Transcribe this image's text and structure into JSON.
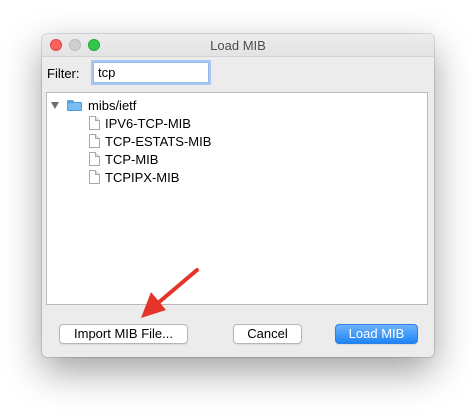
{
  "window": {
    "title": "Load MIB"
  },
  "filter": {
    "label": "Filter:",
    "value": "tcp"
  },
  "tree": {
    "root_label": "mibs/ietf",
    "items": [
      {
        "label": "IPV6-TCP-MIB"
      },
      {
        "label": "TCP-ESTATS-MIB"
      },
      {
        "label": "TCP-MIB"
      },
      {
        "label": "TCPIPX-MIB"
      }
    ]
  },
  "buttons": {
    "import_label": "Import MIB File...",
    "cancel_label": "Cancel",
    "load_label": "Load MIB"
  },
  "colors": {
    "accent": "#1f85f5",
    "annotation_arrow": "#e5352b"
  }
}
